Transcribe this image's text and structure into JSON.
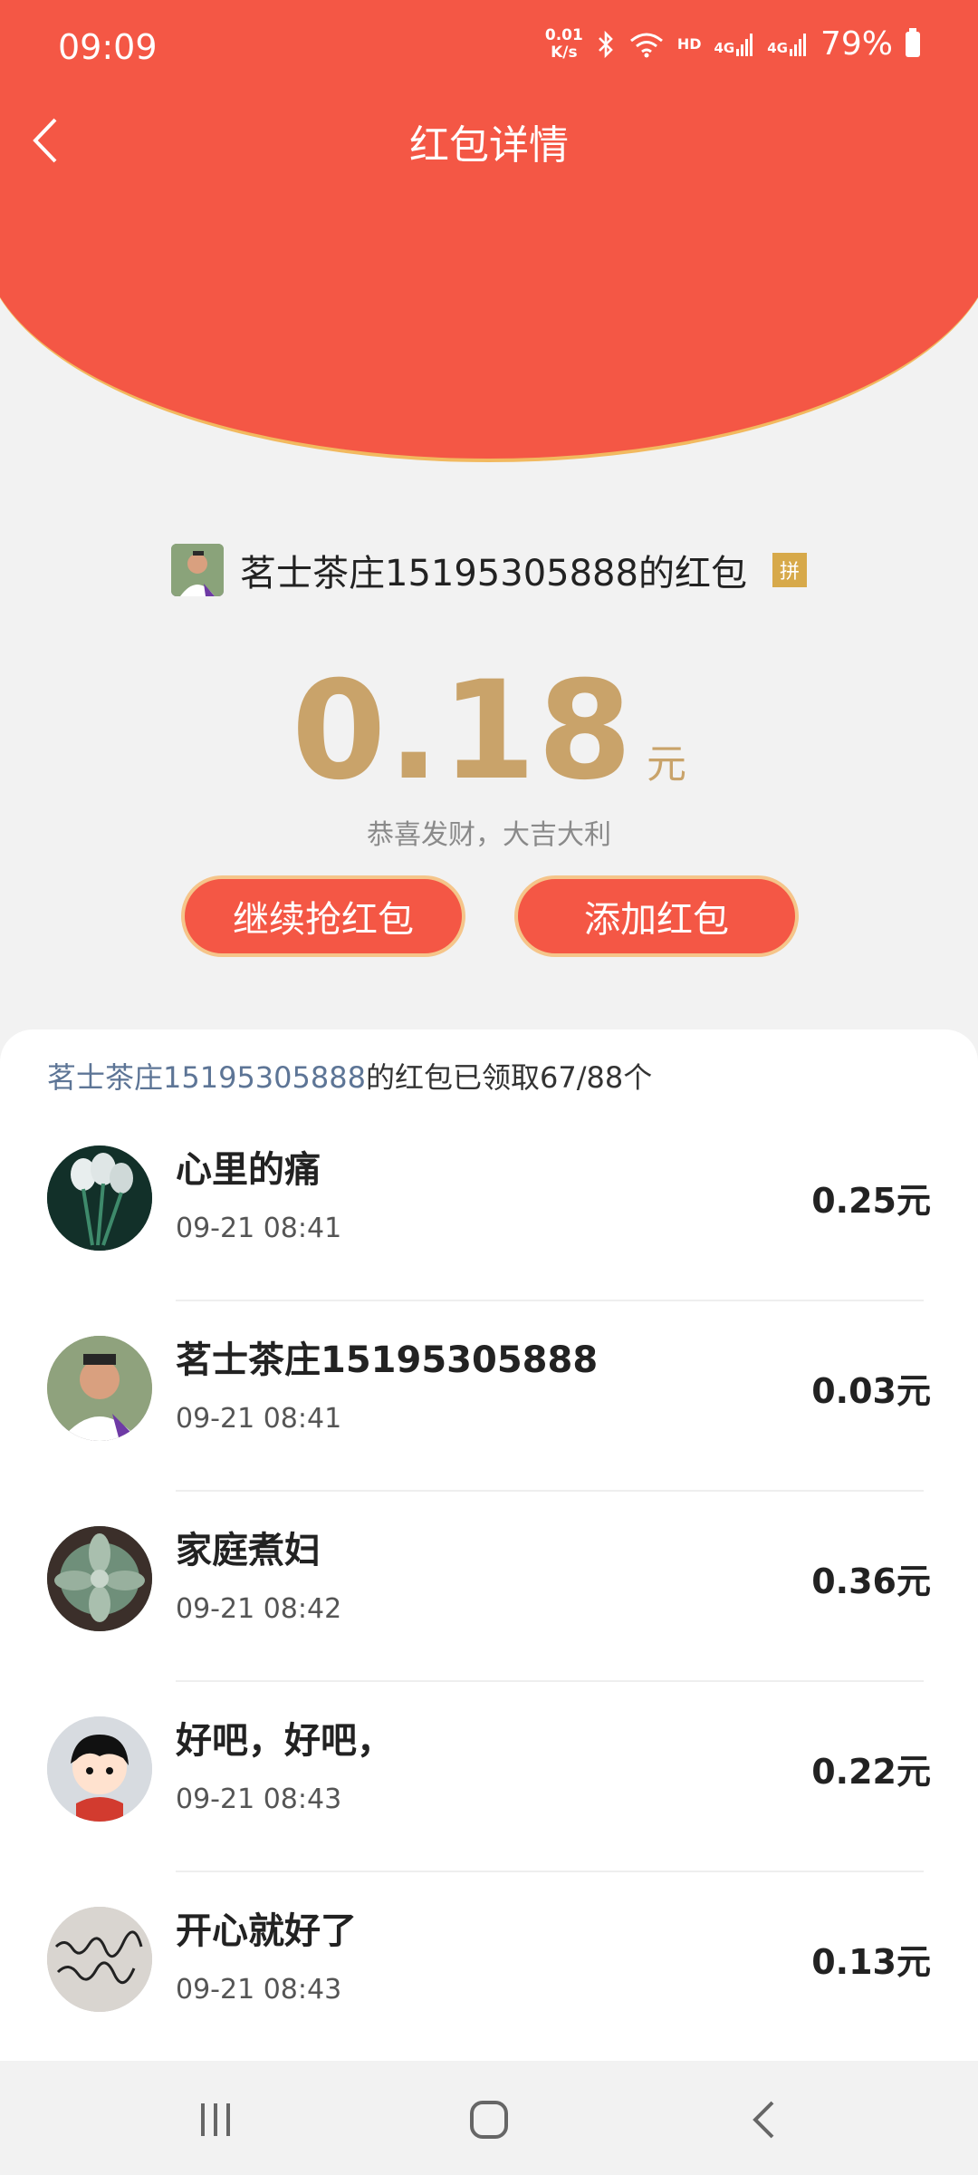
{
  "status_bar": {
    "time": "09:09",
    "net_speed_value": "0.01",
    "net_speed_unit": "K/s",
    "hd_label": "HD",
    "network_1": "4G",
    "network_2": "4G",
    "battery": "79%"
  },
  "header": {
    "title": "红包详情"
  },
  "red_packet": {
    "sender": "茗士茶庄15195305888的红包",
    "badge": "拼",
    "amount": "0.18",
    "unit": "元",
    "blessing": "恭喜发财，大吉大利",
    "continue_button": "继续抢红包",
    "add_button": "添加红包"
  },
  "claims": {
    "summary_name": "茗士茶庄15195305888",
    "summary_text": "的红包已领取67/88个",
    "items": [
      {
        "name": "心里的痛",
        "time": "09-21 08:41",
        "amount": "0.25元"
      },
      {
        "name": "茗士茶庄15195305888",
        "time": "09-21 08:41",
        "amount": "0.03元"
      },
      {
        "name": "家庭煮妇",
        "time": "09-21 08:42",
        "amount": "0.36元"
      },
      {
        "name": "好吧，好吧，",
        "time": "09-21 08:43",
        "amount": "0.22元"
      },
      {
        "name": "开心就好了",
        "time": "09-21 08:43",
        "amount": "0.13元"
      }
    ]
  },
  "colors": {
    "header_red": "#f45745",
    "gold": "#c9a36a",
    "button_border": "#f5c58a"
  }
}
